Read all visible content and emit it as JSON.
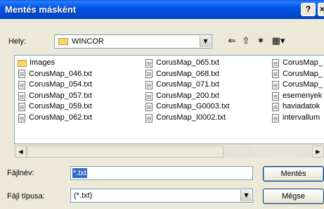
{
  "window": {
    "title": "Mentés másként",
    "help_label": "?",
    "close_label": "×"
  },
  "location": {
    "label": "Hely:",
    "value": "WINCOR"
  },
  "toolbar": {
    "back": "⇐",
    "up": "⇧",
    "new_folder": "✶",
    "view": "▦▾"
  },
  "files": {
    "col1": [
      "Images",
      "CorusMap_046.txt",
      "CorusMap_054.txt",
      "CorusMap_057.txt",
      "CorusMap_059.txt",
      "CorusMap_062.txt"
    ],
    "col2": [
      "CorusMap_065.txt",
      "CorusMap_068.txt",
      "CorusMap_071.txt",
      "CorusMap_200.txt",
      "CorusMap_G0003.txt",
      "CorusMap_I0002.txt"
    ],
    "col3": [
      "CorusMap_",
      "CorusMap_",
      "CorusMap_",
      "esemenyek",
      "haviadatok",
      "intervallum"
    ]
  },
  "filename": {
    "label": "Fájlnév:",
    "value": "*.txt"
  },
  "filetype": {
    "label": "Fájl típusa:",
    "value": "(*.txt)"
  },
  "buttons": {
    "save": "Mentés",
    "cancel": "Mégse"
  }
}
